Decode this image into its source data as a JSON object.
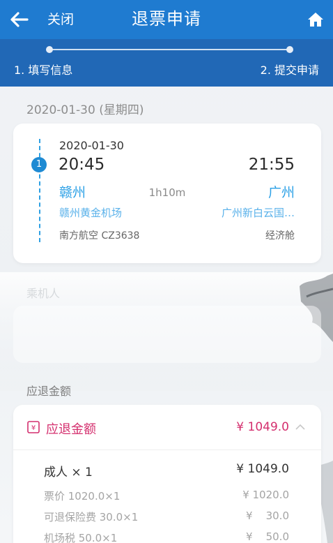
{
  "header": {
    "back_icon": "arrow-left-icon",
    "close_label": "关闭",
    "title": "退票申请",
    "home_icon": "home-icon"
  },
  "steps": {
    "step1_label": "1. 填写信息",
    "step2_label": "2. 提交申请"
  },
  "date_heading": "2020-01-30 (星期四)",
  "flight": {
    "segment_number": "1",
    "date": "2020-01-30",
    "departure_time": "20:45",
    "arrival_time": "21:55",
    "departure_city": "赣州",
    "arrival_city": "广州",
    "duration": "1h10m",
    "departure_airport": "赣州黄金机场",
    "arrival_airport": "广州新白云国…",
    "airline": "南方航空 CZ3638",
    "cabin": "经济舱"
  },
  "passenger": {
    "section_label": "乘机人"
  },
  "refund": {
    "section_label": "应退金额",
    "card_title": "应退金额",
    "total": "¥ 1049.0",
    "adult_label": "成人 × 1",
    "adult_amount": "¥ 1049.0",
    "fees": [
      {
        "label": "票价 1020.0×1",
        "amount": "¥ 1020.0"
      },
      {
        "label": "可退保险费 30.0×1",
        "amount": "¥    30.0"
      },
      {
        "label": "机场税 50.0×1",
        "amount": "¥    50.0"
      }
    ]
  },
  "colors": {
    "header_blue": "#1f7bd0",
    "steps_blue": "#2168b6",
    "city_blue": "#2ba0e6",
    "refund_pink": "#d42f6e"
  }
}
